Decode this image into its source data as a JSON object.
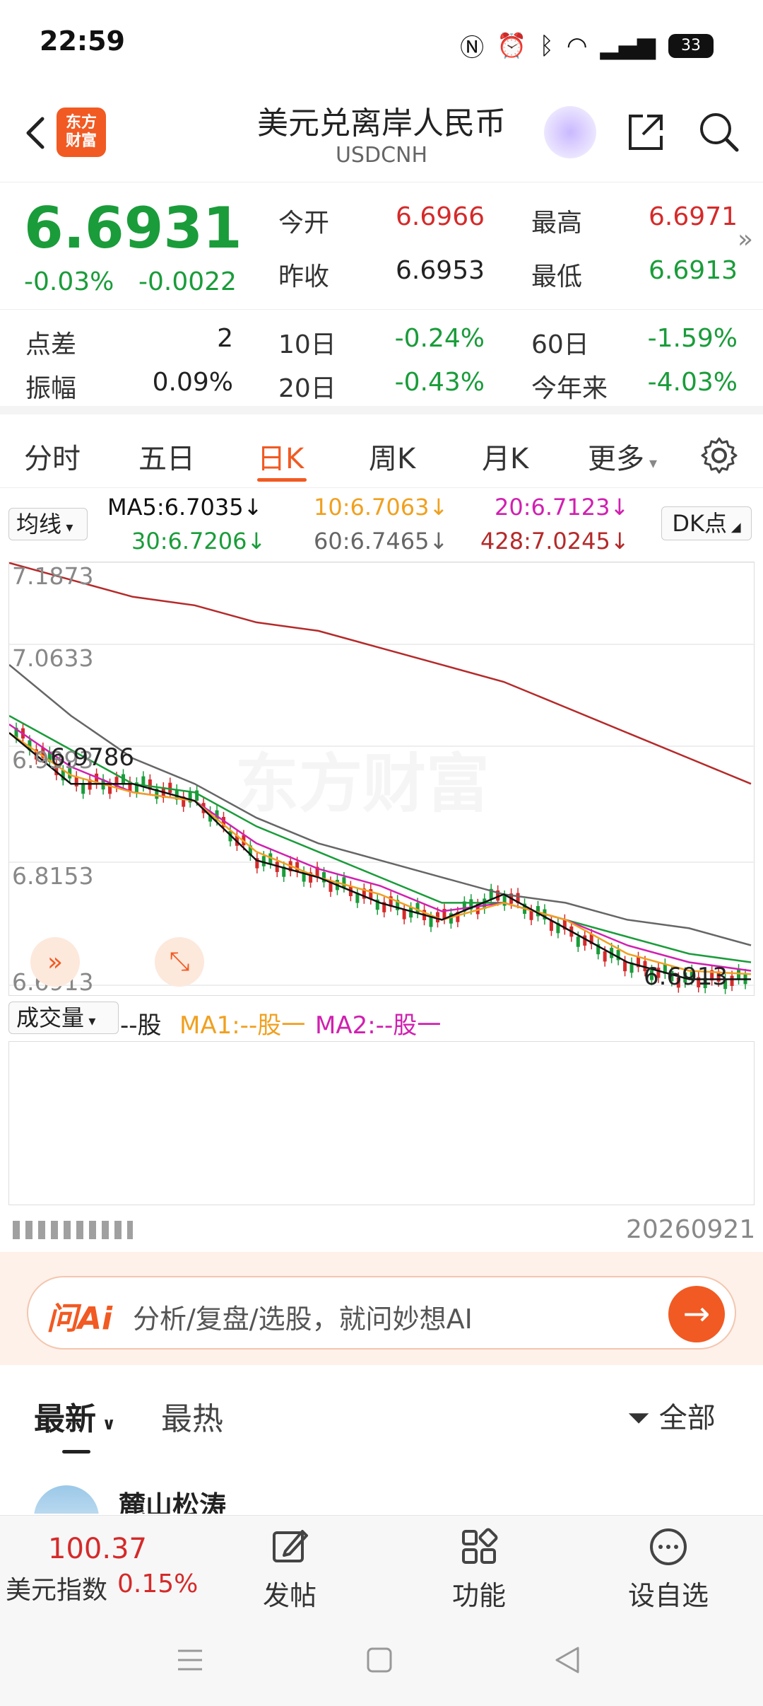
{
  "status": {
    "time": "22:59",
    "battery": "33"
  },
  "header": {
    "logo_line1": "东方",
    "logo_line2": "财富",
    "title": "美元兑离岸人民币",
    "subtitle": "USDCNH"
  },
  "quote": {
    "price": "6.6931",
    "change_pct": "-0.03%",
    "change_abs": "-0.0022",
    "open_label": "今开",
    "open": "6.6966",
    "high_label": "最高",
    "high": "6.6971",
    "prev_label": "昨收",
    "prev": "6.6953",
    "low_label": "最低",
    "low": "6.6913"
  },
  "stats": {
    "spread_label": "点差",
    "spread": "2",
    "d10_label": "10日",
    "d10": "-0.24%",
    "d60_label": "60日",
    "d60": "-1.59%",
    "amp_label": "振幅",
    "amp": "0.09%",
    "d20_label": "20日",
    "d20": "-0.43%",
    "ytd_label": "今年来",
    "ytd": "-4.03%"
  },
  "tabs": [
    "分时",
    "五日",
    "日K",
    "周K",
    "月K",
    "更多"
  ],
  "active_tab": "日K",
  "ma": {
    "select": "均线",
    "ma5": "MA5:6.7035↓",
    "ma10": "10:6.7063↓",
    "ma20": "20:6.7123↓",
    "ma30": "30:6.7206↓",
    "ma60": "60:6.7465↓",
    "ma428": "428:7.0245↓",
    "dk": "DK点"
  },
  "colors": {
    "ma5": "#111111",
    "ma10": "#f0a020",
    "ma20": "#d020b0",
    "ma30": "#1a9c3a",
    "ma60": "#666666",
    "ma428": "#b52a2a",
    "up": "#d52a2a",
    "down": "#1a9c3a",
    "accent": "#f15a22"
  },
  "chart_data": {
    "type": "line",
    "y_ticks": [
      "7.1873",
      "7.0633",
      "6.9393",
      "6.8153",
      "6.6913"
    ],
    "ylim": [
      6.6913,
      7.1873
    ],
    "high_marker": "6.9786",
    "low_marker": "6.6913",
    "watermark": "东方财富",
    "series": [
      {
        "name": "MA428",
        "values": [
          7.19,
          7.17,
          7.15,
          7.14,
          7.12,
          7.11,
          7.09,
          7.07,
          7.05,
          7.02,
          6.99,
          6.96,
          6.93
        ]
      },
      {
        "name": "MA60",
        "values": [
          7.07,
          7.01,
          6.96,
          6.93,
          6.89,
          6.86,
          6.84,
          6.82,
          6.8,
          6.79,
          6.77,
          6.76,
          6.74
        ]
      },
      {
        "name": "MA30",
        "values": [
          7.01,
          6.97,
          6.93,
          6.92,
          6.88,
          6.85,
          6.82,
          6.79,
          6.79,
          6.77,
          6.75,
          6.73,
          6.72
        ]
      },
      {
        "name": "MA20",
        "values": [
          7.0,
          6.95,
          6.92,
          6.91,
          6.86,
          6.83,
          6.81,
          6.78,
          6.79,
          6.77,
          6.74,
          6.72,
          6.71
        ]
      },
      {
        "name": "MA10",
        "values": [
          6.99,
          6.94,
          6.92,
          6.91,
          6.85,
          6.82,
          6.8,
          6.77,
          6.79,
          6.77,
          6.73,
          6.71,
          6.706
        ]
      },
      {
        "name": "MA5",
        "values": [
          6.99,
          6.93,
          6.93,
          6.91,
          6.84,
          6.82,
          6.79,
          6.77,
          6.8,
          6.76,
          6.72,
          6.7,
          6.7
        ]
      }
    ]
  },
  "volume": {
    "select": "成交量",
    "unit": "--股",
    "ma1": "MA1:--股一",
    "ma2": "MA2:--股一",
    "date": "20260921"
  },
  "ai": {
    "logo": "问Ai",
    "placeholder": "分析/复盘/选股，就问妙想AI",
    "send": "→"
  },
  "feed": {
    "tab_latest": "最新",
    "tab_hot": "最热",
    "filter": "全部",
    "author": "麓山松涛"
  },
  "toolbar": {
    "index_value": "100.37",
    "index_name": "美元指数",
    "index_pct": "0.15%",
    "post": "发帖",
    "func": "功能",
    "watch": "设自选"
  }
}
